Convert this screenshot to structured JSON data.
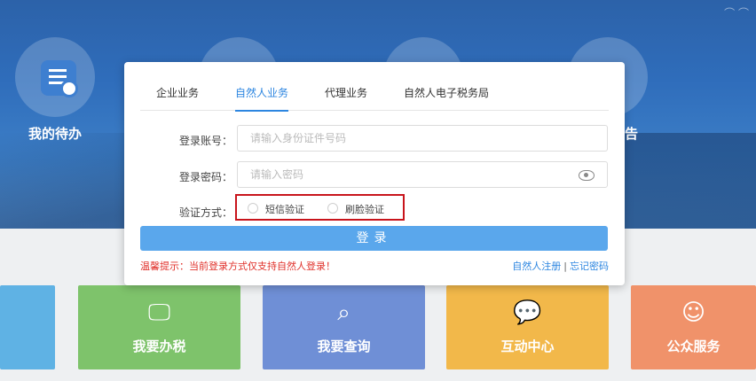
{
  "background": {
    "todo_label": "我的待办",
    "report_label": "告",
    "tiles": [
      {
        "label": "我要办税",
        "icon": "monitor-icon",
        "color": "#7ec36b"
      },
      {
        "label": "我要查询",
        "icon": "search-doc-icon",
        "color": "#6f8fd6"
      },
      {
        "label": "互动中心",
        "icon": "chat-icon",
        "color": "#f2b84a"
      },
      {
        "label": "公众服务",
        "icon": "person-icon",
        "color": "#f0926a"
      }
    ]
  },
  "login": {
    "tabs": [
      {
        "label": "企业业务",
        "active": false
      },
      {
        "label": "自然人业务",
        "active": true
      },
      {
        "label": "代理业务",
        "active": false
      },
      {
        "label": "自然人电子税务局",
        "active": false
      }
    ],
    "account_label": "登录账号：",
    "account_placeholder": "请输入身份证件号码",
    "password_label": "登录密码：",
    "password_placeholder": "请输入密码",
    "verify_label": "验证方式：",
    "verify_options": [
      "短信验证",
      "刷脸验证"
    ],
    "login_button": "登录",
    "hint": "温馨提示：当前登录方式仅支持自然人登录！",
    "register_link": "自然人注册",
    "separator": "|",
    "forgot_link": "忘记密码"
  },
  "colors": {
    "accent": "#2d86e0",
    "button": "#5aa7ec",
    "highlight_box": "#c8141c",
    "hint": "#e0312b"
  }
}
